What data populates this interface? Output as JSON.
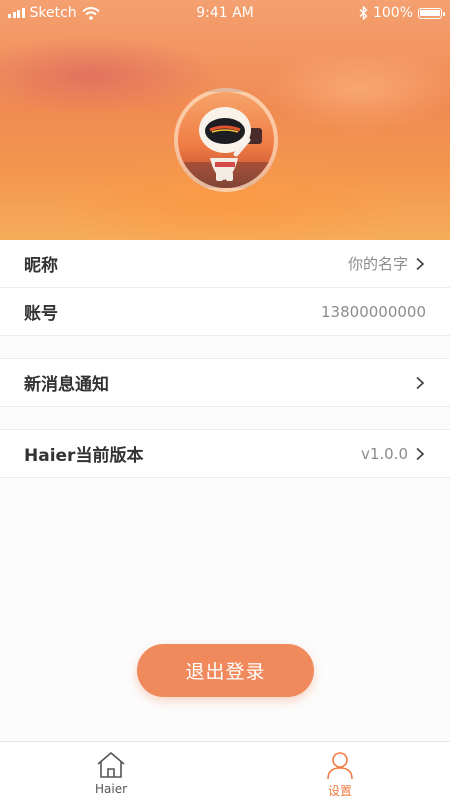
{
  "status_bar": {
    "carrier": "Sketch",
    "time": "9:41 AM",
    "battery": "100%",
    "battery_level": 1.0
  },
  "profile": {
    "avatar_icon": "astronaut-avatar"
  },
  "settings": {
    "nickname": {
      "label": "昵称",
      "value": "你的名字"
    },
    "account": {
      "label": "账号",
      "value": "13800000000"
    },
    "notifications": {
      "label": "新消息通知"
    },
    "version": {
      "label": "Haier当前版本",
      "value": "v1.0.0"
    }
  },
  "logout": {
    "label": "退出登录"
  },
  "tabbar": {
    "home": {
      "label": "Haier",
      "icon": "home-icon"
    },
    "settings": {
      "label": "设置",
      "icon": "user-icon"
    }
  },
  "colors": {
    "accent": "#f08a5c",
    "tab_active": "#f07d45",
    "tab_inactive": "#555555"
  }
}
